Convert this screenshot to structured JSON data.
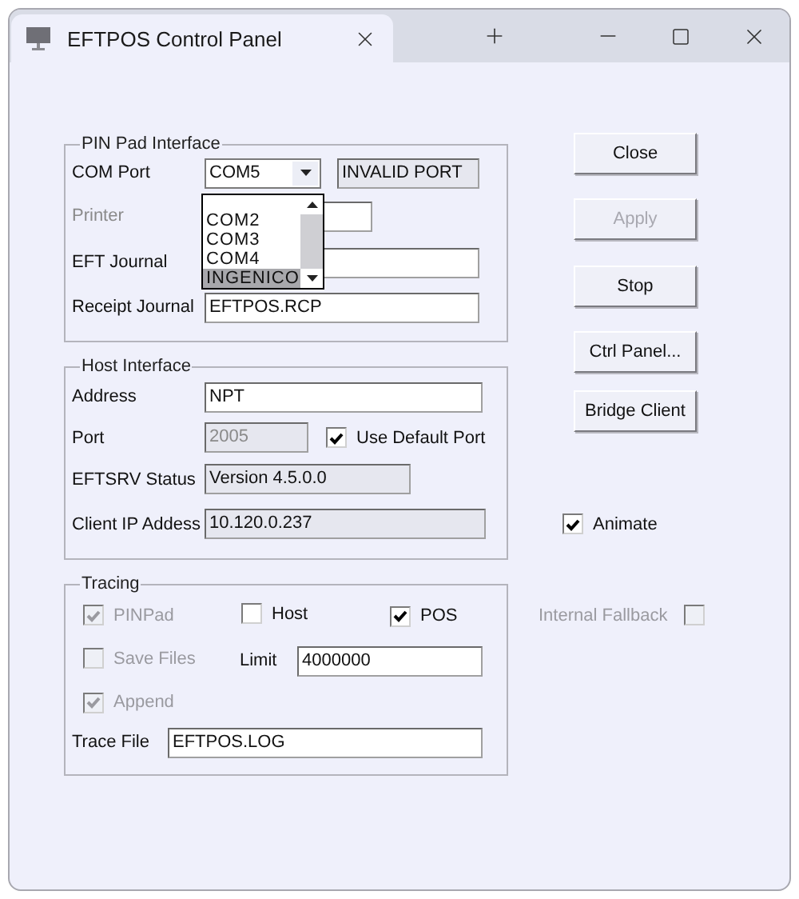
{
  "window": {
    "title": "EFTPOS Control Panel"
  },
  "pin_pad_interface": {
    "title": "PIN Pad Interface",
    "com_port": {
      "label": "COM Port",
      "value": "COM5",
      "status": "INVALID PORT",
      "dropdown": {
        "expanded": true,
        "options": [
          {
            "label": "COM2",
            "selected": false
          },
          {
            "label": "COM3",
            "selected": false
          },
          {
            "label": "COM4",
            "selected": false
          },
          {
            "label": "INGENICO",
            "selected": true
          }
        ]
      }
    },
    "printer": {
      "label": "Printer"
    },
    "eft_journal": {
      "label": "EFT Journal"
    },
    "receipt_journal": {
      "label": "Receipt Journal",
      "value": "EFTPOS.RCP"
    }
  },
  "host_interface": {
    "title": "Host Interface",
    "address": {
      "label": "Address",
      "value": "NPT"
    },
    "port": {
      "label": "Port",
      "value": "2005",
      "disabled": true
    },
    "use_default_port": {
      "label": "Use Default Port",
      "checked": true
    },
    "eftsrv_status": {
      "label": "EFTSRV Status",
      "value": "Version 4.5.0.0"
    },
    "client_ip": {
      "label": "Client IP Addess",
      "value": "10.120.0.237"
    }
  },
  "tracing": {
    "title": "Tracing",
    "pinpad": {
      "label": "PINPad",
      "checked": true,
      "disabled": true
    },
    "host": {
      "label": "Host",
      "checked": false,
      "disabled": false
    },
    "pos": {
      "label": "POS",
      "checked": true,
      "disabled": false
    },
    "save_files": {
      "label": "Save Files",
      "checked": false,
      "disabled": true
    },
    "limit": {
      "label": "Limit",
      "value": "4000000"
    },
    "append": {
      "label": "Append",
      "checked": true,
      "disabled": true
    },
    "trace_file": {
      "label": "Trace File",
      "value": "EFTPOS.LOG"
    }
  },
  "buttons": [
    {
      "label": "Close",
      "disabled": false
    },
    {
      "label": "Apply",
      "disabled": true
    },
    {
      "label": "Stop",
      "disabled": false
    },
    {
      "label": "Ctrl Panel...",
      "disabled": false
    },
    {
      "label": "Bridge Client",
      "disabled": false
    }
  ],
  "animate": {
    "label": "Animate",
    "checked": true,
    "disabled": false
  },
  "internal_fallback": {
    "label": "Internal Fallback",
    "checked": false,
    "disabled": true
  }
}
